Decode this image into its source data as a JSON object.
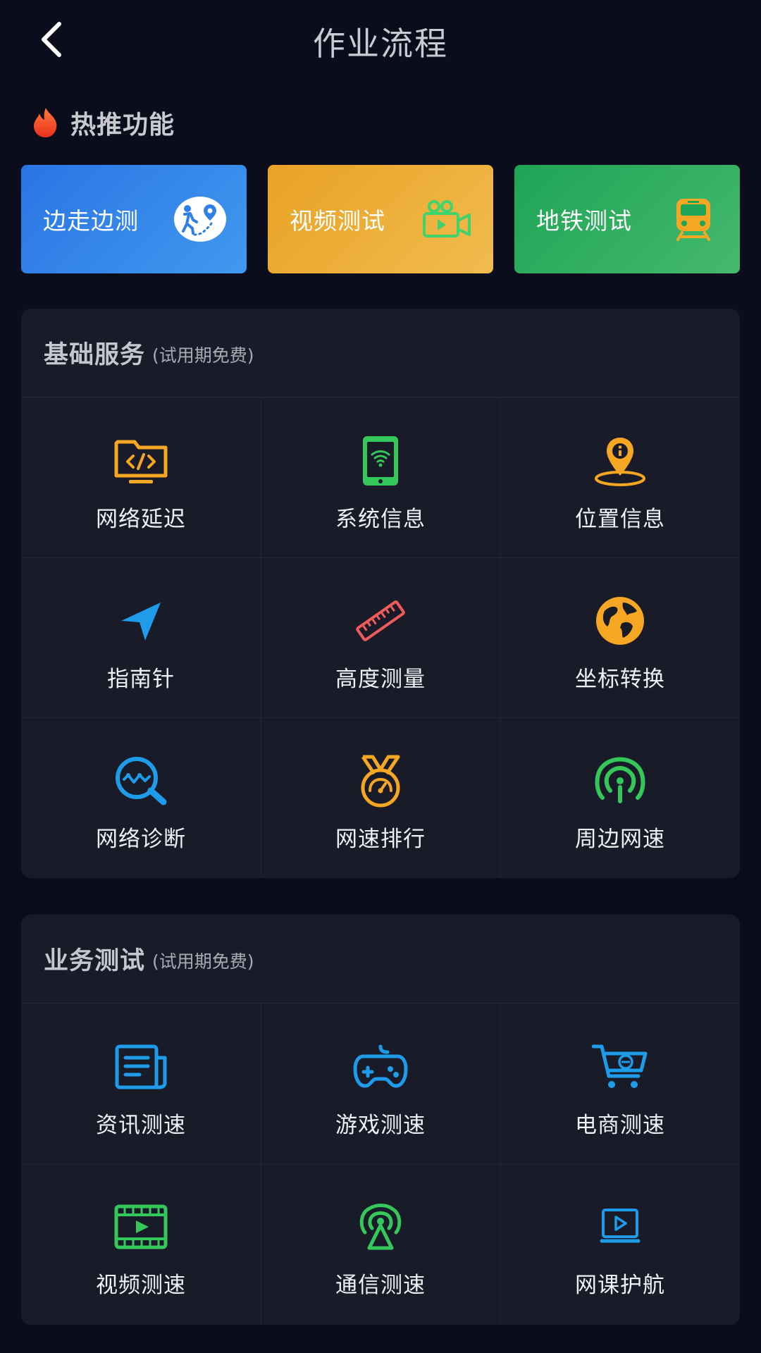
{
  "header": {
    "title": "作业流程",
    "back_icon": "back-arrow-icon"
  },
  "hot": {
    "title": "热推功能",
    "icon": "flame-icon",
    "cards": [
      {
        "label": "边走边测",
        "icon": "walk-route-icon",
        "color": "#2a74e4"
      },
      {
        "label": "视频测试",
        "icon": "video-camera-icon",
        "color": "#e9a224"
      },
      {
        "label": "地铁测试",
        "icon": "subway-train-icon",
        "color": "#1ea456"
      }
    ]
  },
  "basic": {
    "title": "基础服务",
    "subtitle": "(试用期免费)",
    "items": [
      {
        "label": "网络延迟",
        "icon": "code-folder-icon",
        "color": "#f5a623"
      },
      {
        "label": "系统信息",
        "icon": "phone-wifi-icon",
        "color": "#34c759"
      },
      {
        "label": "位置信息",
        "icon": "location-pin-icon",
        "color": "#f5a623"
      },
      {
        "label": "指南针",
        "icon": "compass-arrow-icon",
        "color": "#1e9be9"
      },
      {
        "label": "高度测量",
        "icon": "ruler-icon",
        "color": "#ef5b5b"
      },
      {
        "label": "坐标转换",
        "icon": "globe-icon",
        "color": "#f5a623"
      },
      {
        "label": "网络诊断",
        "icon": "magnifier-wave-icon",
        "color": "#1e9be9"
      },
      {
        "label": "网速排行",
        "icon": "medal-gauge-icon",
        "color": "#f5a623"
      },
      {
        "label": "周边网速",
        "icon": "signal-antenna-icon",
        "color": "#34c759"
      }
    ]
  },
  "business": {
    "title": "业务测试",
    "subtitle": "(试用期免费)",
    "items": [
      {
        "label": "资讯测速",
        "icon": "news-icon",
        "color": "#1e9be9"
      },
      {
        "label": "游戏测速",
        "icon": "gamepad-icon",
        "color": "#1e9be9"
      },
      {
        "label": "电商测速",
        "icon": "shopping-cart-icon",
        "color": "#1e9be9"
      },
      {
        "label": "视频测速",
        "icon": "film-icon",
        "color": "#34c759"
      },
      {
        "label": "通信测速",
        "icon": "broadcast-tower-icon",
        "color": "#34c759"
      },
      {
        "label": "网课护航",
        "icon": "online-class-icon",
        "color": "#1e9be9"
      }
    ]
  }
}
